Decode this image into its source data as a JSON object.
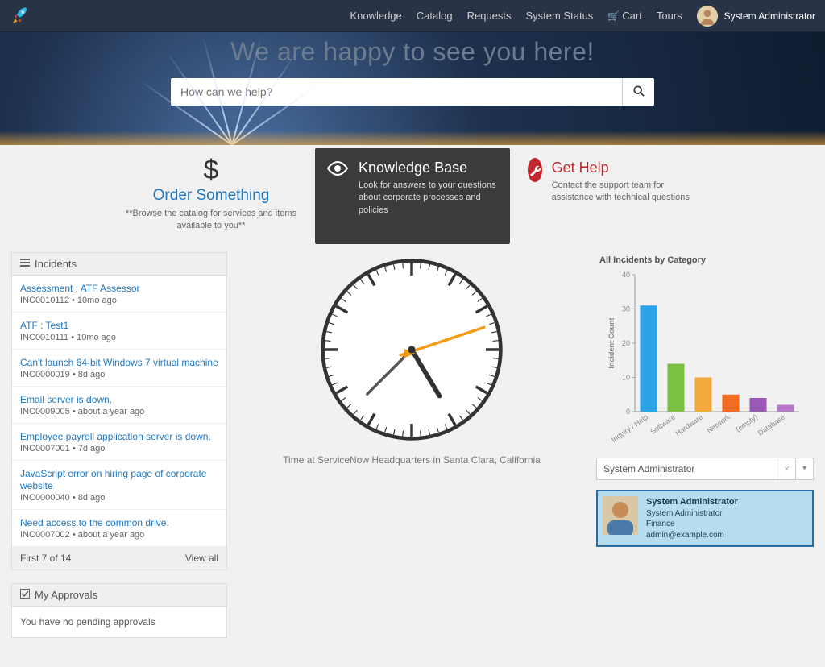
{
  "nav": {
    "items": [
      {
        "label": "Knowledge"
      },
      {
        "label": "Catalog"
      },
      {
        "label": "Requests"
      },
      {
        "label": "System Status"
      },
      {
        "label": "Cart",
        "is_cart": true
      },
      {
        "label": "Tours"
      }
    ],
    "user_name": "System Administrator"
  },
  "hero": {
    "headline": "We are happy to see you here!",
    "search_placeholder": "How can we help?"
  },
  "promos": {
    "order": {
      "title": "Order Something",
      "desc": "**Browse the catalog for services and items available to you**"
    },
    "kb": {
      "title": "Knowledge Base",
      "desc": "Look for answers to your questions about corporate processes and policies"
    },
    "help": {
      "title": "Get Help",
      "desc": "Contact the support team for assistance with technical questions"
    }
  },
  "incidents": {
    "header": "Incidents",
    "footer_left": "First 7 of 14",
    "footer_right": "View all",
    "items": [
      {
        "title": "Assessment : ATF Assessor",
        "meta": "INC0010112 • 10mo ago"
      },
      {
        "title": "ATF : Test1",
        "meta": "INC0010111 • 10mo ago"
      },
      {
        "title": "Can't launch 64-bit Windows 7 virtual machine",
        "meta": "INC0000019 • 8d ago"
      },
      {
        "title": "Email server is down.",
        "meta": "INC0009005 • about a year ago"
      },
      {
        "title": "Employee payroll application server is down.",
        "meta": "INC0007001 • 7d ago"
      },
      {
        "title": "JavaScript error on hiring page of corporate website",
        "meta": "INC0000040 • 8d ago"
      },
      {
        "title": "Need access to the common drive.",
        "meta": "INC0007002 • about a year ago"
      }
    ]
  },
  "approvals": {
    "header": "My Approvals",
    "empty": "You have no pending approvals"
  },
  "clock": {
    "caption": "Time at ServiceNow Headquarters in Santa Clara, California"
  },
  "chart_data": {
    "type": "bar",
    "title": "All Incidents by Category",
    "ylabel": "Incident Count",
    "ylim": [
      0,
      40
    ],
    "yticks": [
      0,
      10,
      20,
      30,
      40
    ],
    "categories": [
      "Inquiry / Help",
      "Software",
      "Hardware",
      "Network",
      "(empty)",
      "Database"
    ],
    "values": [
      31,
      14,
      10,
      5,
      4,
      2
    ],
    "colors": [
      "#2aa3e8",
      "#7bc043",
      "#f2a93b",
      "#f26d21",
      "#9b59b6",
      "#b978c9"
    ]
  },
  "user_select": {
    "value": "System Administrator"
  },
  "user_card": {
    "name": "System Administrator",
    "role": "System Administrator",
    "dept": "Finance",
    "email": "admin@example.com"
  }
}
